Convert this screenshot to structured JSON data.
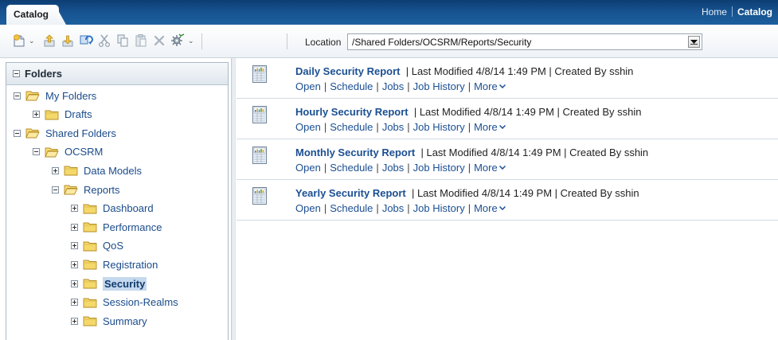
{
  "top_tab": {
    "label": "Catalog"
  },
  "top_links": {
    "home": "Home",
    "catalog": "Catalog"
  },
  "toolbar": {
    "buttons": [
      {
        "icon": "new-icon",
        "has_menu": true
      },
      {
        "icon": "upload-icon"
      },
      {
        "icon": "download-icon"
      },
      {
        "icon": "refresh-icon"
      },
      {
        "icon": "cut-icon"
      },
      {
        "icon": "copy-icon"
      },
      {
        "icon": "paste-icon"
      },
      {
        "icon": "delete-icon"
      },
      {
        "icon": "tasks-icon",
        "has_menu": true
      }
    ],
    "location_label": "Location",
    "location_value": "/Shared Folders/OCSRM/Reports/Security"
  },
  "folders_pane": {
    "title": "Folders",
    "tree": [
      {
        "label": "My Folders",
        "depth": 0,
        "expanded": true
      },
      {
        "label": "Drafts",
        "depth": 1,
        "expanded": false
      },
      {
        "label": "Shared Folders",
        "depth": 0,
        "expanded": true
      },
      {
        "label": "OCSRM",
        "depth": 1,
        "expanded": true
      },
      {
        "label": "Data Models",
        "depth": 2,
        "expanded": false
      },
      {
        "label": "Reports",
        "depth": 2,
        "expanded": true
      },
      {
        "label": "Dashboard",
        "depth": 3,
        "expanded": false
      },
      {
        "label": "Performance",
        "depth": 3,
        "expanded": false
      },
      {
        "label": "QoS",
        "depth": 3,
        "expanded": false
      },
      {
        "label": "Registration",
        "depth": 3,
        "expanded": false
      },
      {
        "label": "Security",
        "depth": 3,
        "expanded": false,
        "selected": true
      },
      {
        "label": "Session-Realms",
        "depth": 3,
        "expanded": false
      },
      {
        "label": "Summary",
        "depth": 3,
        "expanded": false
      }
    ]
  },
  "reports": [
    {
      "title": "Daily Security Report",
      "meta": "Last Modified 4/8/14 1:49 PM | Created By sshin"
    },
    {
      "title": "Hourly Security Report",
      "meta": "Last Modified 4/8/14 1:49 PM | Created By sshin"
    },
    {
      "title": "Monthly Security Report",
      "meta": "Last Modified 4/8/14 1:49 PM | Created By sshin"
    },
    {
      "title": "Yearly Security Report",
      "meta": "Last Modified 4/8/14 1:49 PM | Created By sshin"
    }
  ],
  "report_actions": {
    "open": "Open",
    "schedule": "Schedule",
    "jobs": "Jobs",
    "job_history": "Job History",
    "more": "More"
  },
  "colors": {
    "link": "#1b4f92",
    "header_blue": "#16528f",
    "selected_bg": "#c5d8ee"
  }
}
